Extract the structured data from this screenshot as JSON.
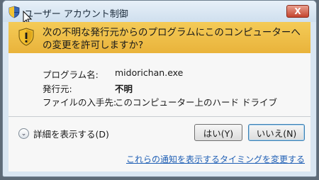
{
  "window": {
    "title": "ユーザー アカウント制御",
    "close_label": "X"
  },
  "banner": {
    "message": "次の不明な発行元からのプログラムにこのコンピューターへの変更を許可しますか?"
  },
  "details": {
    "program_name_label": "プログラム名:",
    "program_name_value": "midorichan.exe",
    "publisher_label": "発行元:",
    "publisher_value": "不明",
    "source_label": "ファイルの入手先:",
    "source_value": "このコンピューター上のハード ドライブ"
  },
  "footer": {
    "show_details_label": "詳細を表示する(D)",
    "yes_label": "はい(Y)",
    "no_label": "いいえ(N)",
    "notification_link": "これらの通知を表示するタイミングを変更する"
  },
  "colors": {
    "banner": "#e9b33b",
    "link": "#1f5fb5",
    "close_button": "#c4442e"
  }
}
